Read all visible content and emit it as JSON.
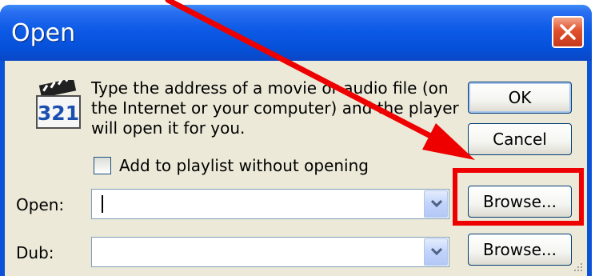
{
  "window": {
    "title": "Open"
  },
  "dialog": {
    "description_lines": [
      "Type the address of a movie or audio file (on",
      "the Internet or your computer) and the player",
      "will open it for you."
    ],
    "icon_text": "321",
    "checkbox_label": "Add to playlist without opening",
    "checkbox_checked": false,
    "open_label": "Open:",
    "open_value": "",
    "dub_label": "Dub:",
    "dub_value": "",
    "ok_label": "OK",
    "cancel_label": "Cancel",
    "browse_open_label": "Browse...",
    "browse_dub_label": "Browse..."
  },
  "annotation": {
    "highlight_color": "#ee0000",
    "arrow_color": "#ee0000"
  },
  "colors": {
    "titlebar": "#0650d8",
    "client": "#ece9d8",
    "close": "#e0502e",
    "button_border": "#003c74"
  }
}
